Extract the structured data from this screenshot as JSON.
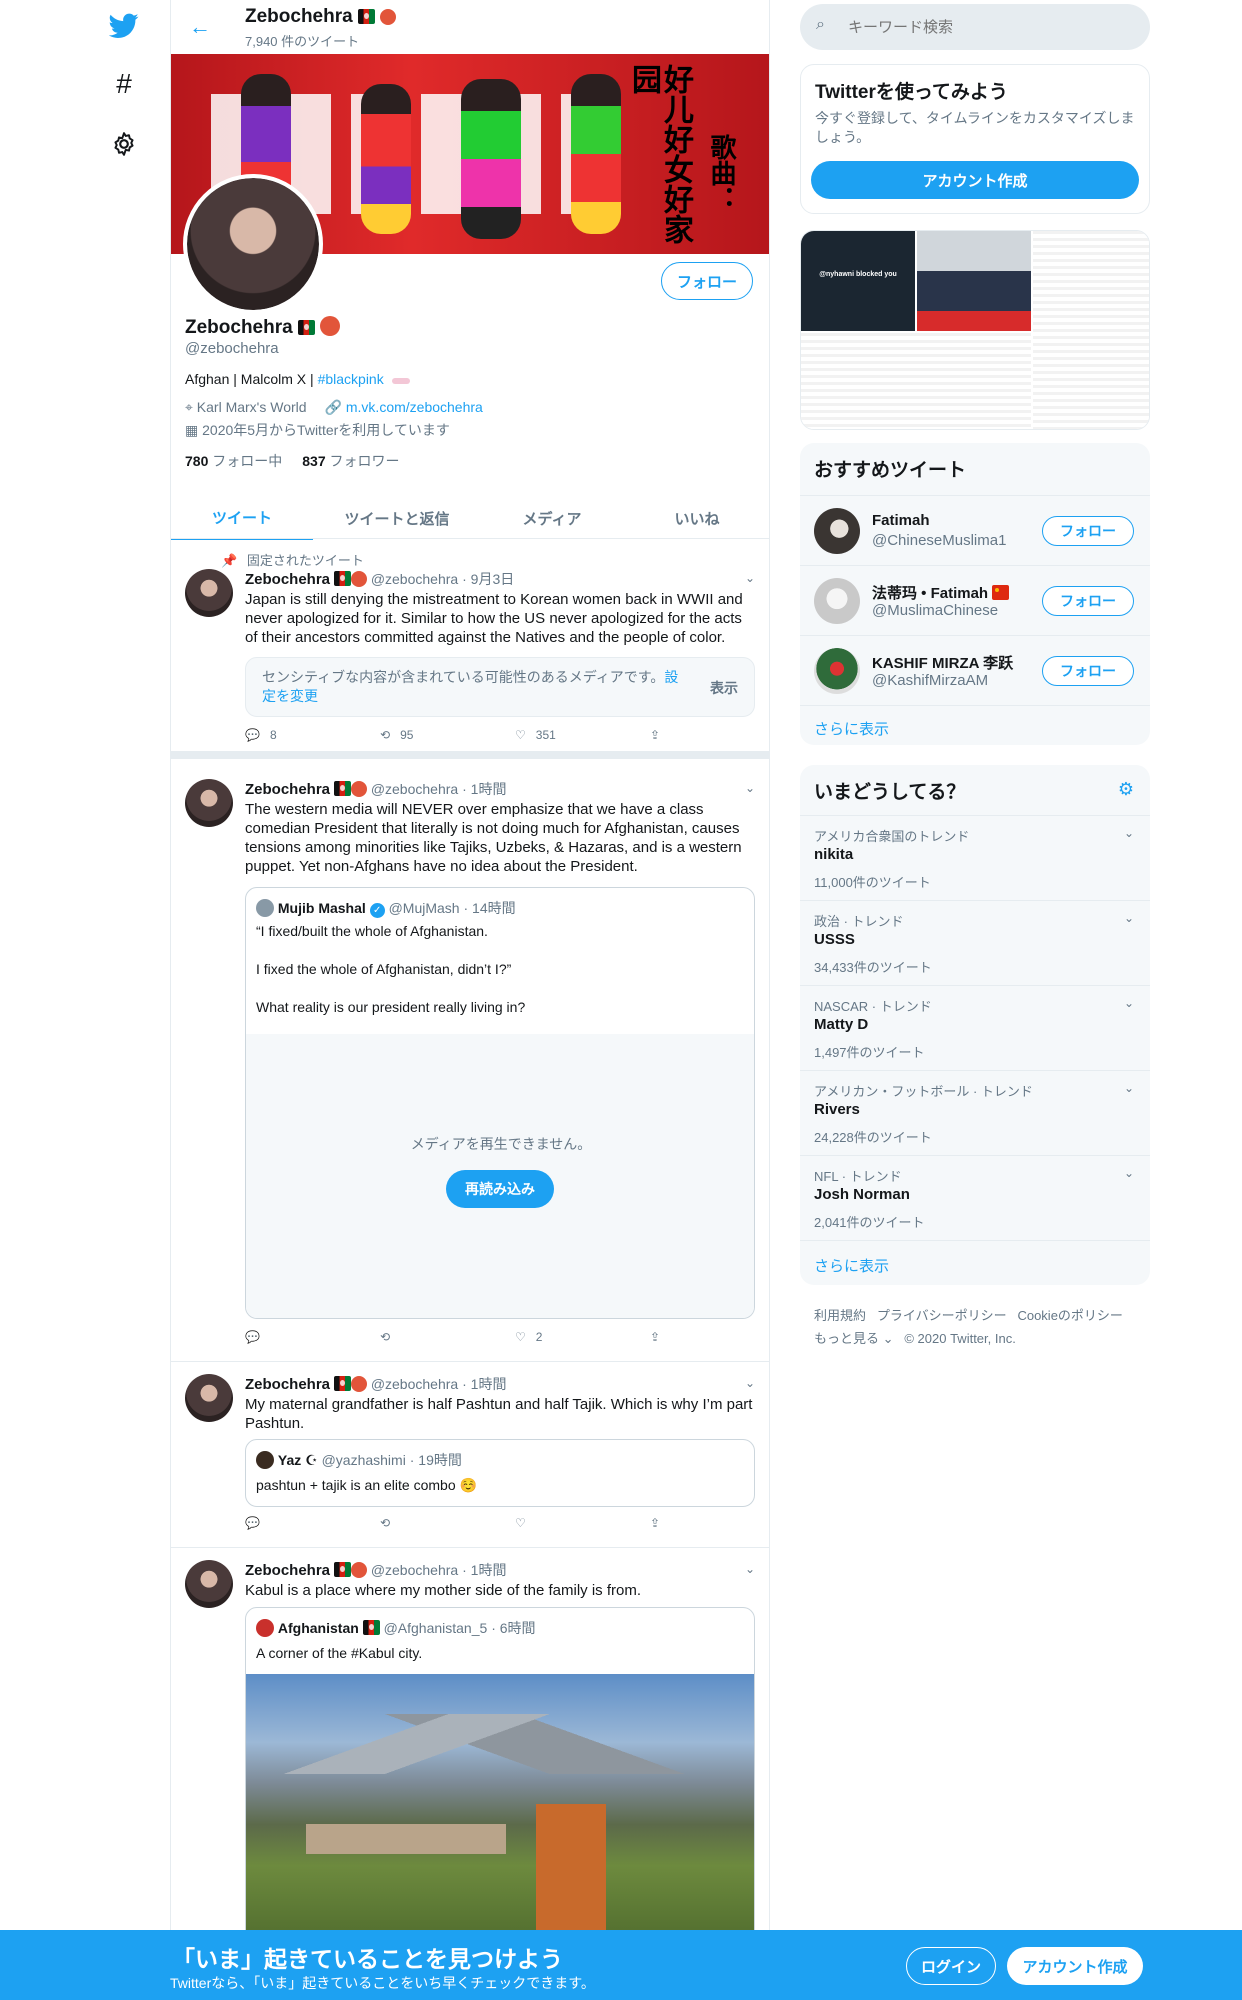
{
  "header": {
    "name": "Zebochehra",
    "tweet_count": "7,940 件のツイート"
  },
  "banner": {
    "title_text": "好儿好女好家园",
    "song_label": "歌曲："
  },
  "profile": {
    "name": "Zebochehra",
    "handle": "@zebochehra",
    "follow_label": "フォロー",
    "bio_prefix": "Afghan | Malcolm X | ",
    "bio_hashtag": "#blackpink",
    "location": "Karl Marx's World",
    "url": "m.vk.com/zebochehra",
    "joined": "2020年5月からTwitterを利用しています",
    "following_count": "780",
    "following_label": "フォロー中",
    "followers_count": "837",
    "followers_label": "フォロワー"
  },
  "tabs": [
    {
      "label": "ツイート"
    },
    {
      "label": "ツイートと返信"
    },
    {
      "label": "メディア"
    },
    {
      "label": "いいね"
    }
  ],
  "tweets": [
    {
      "pinned_label": "固定されたツイート",
      "name": "Zebochehra",
      "handle": "@zebochehra",
      "time": "9月3日",
      "text": "Japan is still denying the mistreatment to Korean women back in WWII and never apologized for it. Similar to how the US never apologized for the acts of their ancestors committed against the Natives and the people of color.",
      "sensitive_text": "センシティブな内容が含まれている可能性のあるメディアです。",
      "sensitive_link": "設定を変更",
      "sensitive_show": "表示",
      "replies": "8",
      "retweets": "95",
      "likes": "351"
    },
    {
      "name": "Zebochehra",
      "handle": "@zebochehra",
      "time": "1時間",
      "text": "The western media will NEVER over emphasize that we have a class comedian President that literally is not doing much for Afghanistan, causes tensions among minorities like Tajiks, Uzbeks, & Hazaras, and is a western puppet. Yet non-Afghans have no idea about the President.",
      "quote": {
        "name": "Mujib Mashal",
        "handle": "@MujMash",
        "time": "14時間",
        "line1": "“I fixed/built the whole of Afghanistan.",
        "line2": "I fixed the whole of Afghanistan, didn’t I?”",
        "line3": "What reality is our president really living in?",
        "media_error": "メディアを再生できません。",
        "reload_label": "再読み込み"
      },
      "replies": "",
      "retweets": "",
      "likes": "2"
    },
    {
      "name": "Zebochehra",
      "handle": "@zebochehra",
      "time": "1時間",
      "text": "My maternal grandfather is half Pashtun and half Tajik. Which is why I’m part Pashtun.",
      "quote": {
        "name": "Yaz ☪",
        "handle": "@yazhashimi",
        "time": "19時間",
        "text": "pashtun + tajik is an elite combo ☺️"
      }
    },
    {
      "name": "Zebochehra",
      "handle": "@zebochehra",
      "time": "1時間",
      "text": "Kabul is a place where my mother side of the family is from.",
      "quote": {
        "name": "Afghanistan",
        "handle": "@Afghanistan_5",
        "time": "6時間",
        "text": "A corner of the #Kabul city."
      }
    }
  ],
  "search": {
    "placeholder": "キーワード検索"
  },
  "signup_card": {
    "title": "Twitterを使ってみよう",
    "desc": "今すぐ登録して、タイムラインをカスタマイズしましょう。",
    "button": "アカウント作成"
  },
  "media_card": {
    "panel1_text": "@nyhawni blocked you"
  },
  "who_to_follow": {
    "title": "おすすめツイート",
    "follow_label": "フォロー",
    "show_more": "さらに表示",
    "users": [
      {
        "name": "Fatimah",
        "handle": "@ChineseMuslima1"
      },
      {
        "name": "法蒂玛 • Fatimah",
        "handle": "@MuslimaChinese"
      },
      {
        "name": "KASHIF MIRZA 李跃",
        "handle": "@KashifMirzaAM"
      }
    ]
  },
  "trends": {
    "title": "いまどうしてる？",
    "show_more": "さらに表示",
    "items": [
      {
        "context": "アメリカ合衆国のトレンド",
        "name": "nikita",
        "count": "11,000件のツイート"
      },
      {
        "context": "政治 · トレンド",
        "name": "USSS",
        "count": "34,433件のツイート"
      },
      {
        "context": "NASCAR · トレンド",
        "name": "Matty D",
        "count": "1,497件のツイート"
      },
      {
        "context": "アメリカン・フットボール · トレンド",
        "name": "Rivers",
        "count": "24,228件のツイート"
      },
      {
        "context": "NFL · トレンド",
        "name": "Josh Norman",
        "count": "2,041件のツイート"
      }
    ]
  },
  "footer": {
    "terms": "利用規約",
    "privacy": "プライバシーポリシー",
    "cookie": "Cookieのポリシー",
    "more": "もっと見る ⌄",
    "copyright": "© 2020 Twitter, Inc."
  },
  "bottom_bar": {
    "headline": "「いま」起きていることを見つけよう",
    "subtext": "Twitterなら、「いま」起きていることをいち早くチェックできます。",
    "login": "ログイン",
    "signup": "アカウント作成"
  },
  "colors": {
    "brand": "#1da1f2",
    "banner": "#c41d20",
    "bottom_bar": "#1da1f2"
  }
}
